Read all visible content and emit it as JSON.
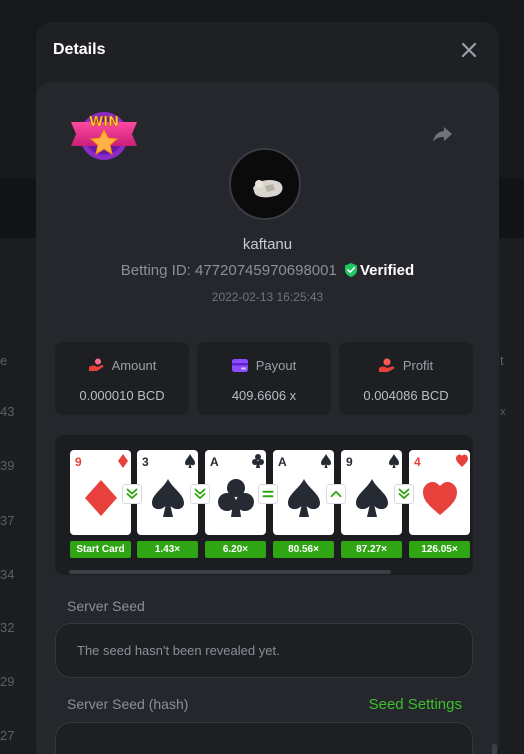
{
  "background": {
    "left_numbers": [
      "e",
      "43",
      "39",
      "37",
      "34",
      "32",
      "29",
      "27"
    ],
    "right_numbers": [
      "t",
      "x"
    ]
  },
  "modal": {
    "title": "Details",
    "win_badge_text": "WIN",
    "username": "kaftanu",
    "betting_id_label": "Betting ID:",
    "betting_id": "47720745970698001",
    "verified_label": "Verified",
    "date": "2022-02-13 16:25:43",
    "stats": {
      "amount": {
        "label": "Amount",
        "value": "0.000010 BCD"
      },
      "payout": {
        "label": "Payout",
        "value": "409.6606 x"
      },
      "profit": {
        "label": "Profit",
        "value": "0.004086 BCD"
      }
    },
    "cards": [
      {
        "rank": "9",
        "suit": "diamond",
        "color": "red",
        "multiplier": "Start Card"
      },
      {
        "rank": "3",
        "suit": "spade",
        "color": "black",
        "multiplier": "1.43×"
      },
      {
        "rank": "A",
        "suit": "club",
        "color": "black",
        "multiplier": "6.20×"
      },
      {
        "rank": "A",
        "suit": "spade",
        "color": "black",
        "multiplier": "80.56×"
      },
      {
        "rank": "9",
        "suit": "spade",
        "color": "black",
        "multiplier": "87.27×"
      },
      {
        "rank": "4",
        "suit": "heart",
        "color": "red",
        "multiplier": "126.05×"
      }
    ],
    "guesses": [
      "lower-or-equal",
      "lower-or-equal",
      "equal",
      "higher",
      "lower-or-equal"
    ],
    "server_seed_label": "Server Seed",
    "server_seed_value": "The seed hasn't been revealed yet.",
    "server_seed_hash_label": "Server Seed (hash)",
    "seed_settings_label": "Seed Settings"
  },
  "colors": {
    "accent_green": "#3cc12a",
    "multiplier_green": "#2fa514",
    "verified_shield": "#22c55e",
    "card_red": "#e8413c",
    "card_black": "#252a33"
  }
}
